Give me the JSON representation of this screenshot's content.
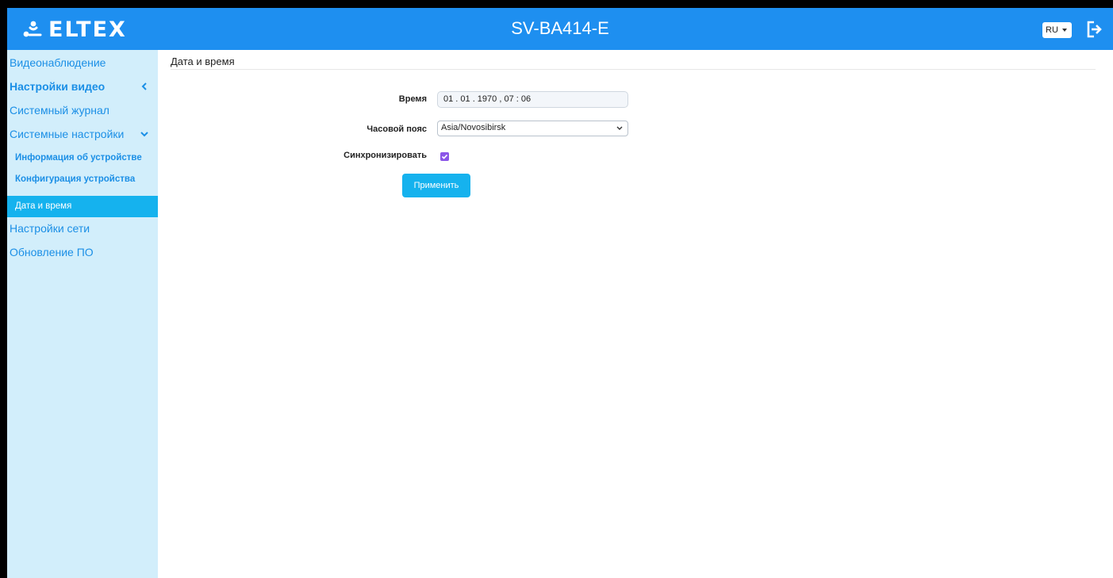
{
  "header": {
    "logo_text": "ELTEX",
    "device_title": "SV-BA414-E",
    "language": "RU"
  },
  "sidebar": {
    "items": [
      {
        "label": "Видеонаблюдение"
      },
      {
        "label": "Настройки видео",
        "chevron": "chevron-left-icon"
      },
      {
        "label": "Системный журнал"
      },
      {
        "label": "Системные настройки",
        "chevron": "chevron-down-icon"
      },
      {
        "label": "Информация об устройстве"
      },
      {
        "label": "Конфигурация устройства"
      },
      {
        "label": "Дата и время",
        "active": true
      },
      {
        "label": "Настройки сети"
      },
      {
        "label": "Обновление ПО"
      }
    ]
  },
  "content": {
    "title": "Дата и время",
    "time_label": "Время",
    "time_value": "01 . 01 . 1970 ,  07 : 06",
    "timezone_label": "Часовой пояс",
    "timezone_value": "Asia/Novosibirsk",
    "sync_label": "Синхронизировать",
    "sync_checked": true,
    "apply_label": "Применить"
  },
  "colors": {
    "header": "#1e8ff0",
    "sidebar_bg": "#d2eefb",
    "link": "#1b8fe6",
    "active": "#15b2ee",
    "checkbox": "#8b55e8"
  }
}
